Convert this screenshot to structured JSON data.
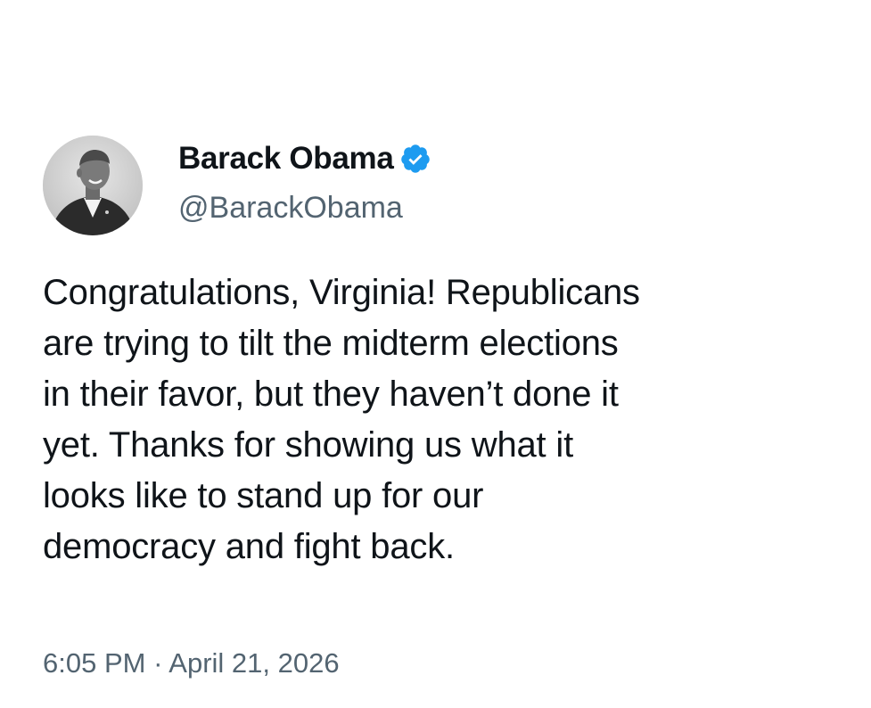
{
  "author": {
    "display_name": "Barack Obama",
    "handle": "@BarackObama",
    "verified": true,
    "avatar_icon": "profile-photo",
    "verified_icon": "verified-badge-icon",
    "verified_color": "#1d9bf0"
  },
  "tweet": {
    "lines": [
      "Congratulations, Virginia! Republicans",
      "are trying to tilt the midterm elections",
      "in their favor, but they haven’t done it",
      "yet. Thanks for showing us what it",
      "looks like to stand up for our",
      "democracy and fight back."
    ]
  },
  "meta": {
    "time": "6:05 PM",
    "separator": " · ",
    "date": "April 21, 2026"
  },
  "colors": {
    "text": "#0f1419",
    "secondary": "#536471",
    "background": "#ffffff"
  }
}
